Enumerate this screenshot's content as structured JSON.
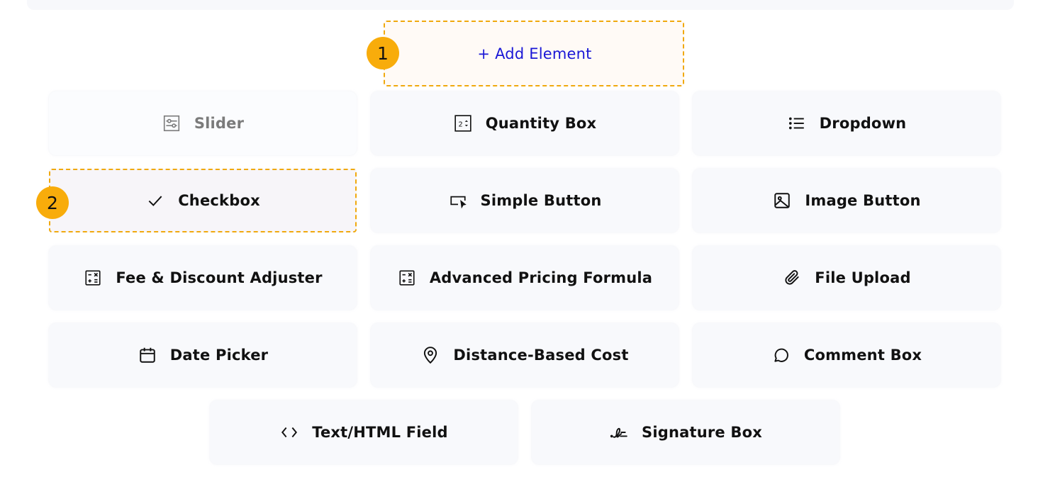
{
  "add_element": {
    "label": "+ Add Element"
  },
  "markers": [
    "1",
    "2"
  ],
  "colors": {
    "accent": "#f0a90e",
    "marker": "#f8ac0b",
    "link": "#1a17d6",
    "card_bg": "#f8f9fc",
    "disabled_text": "#7b7b7b"
  },
  "elements": [
    {
      "label": "Slider",
      "icon": "slider-icon",
      "state": "disabled"
    },
    {
      "label": "Quantity Box",
      "icon": "quantity-box-icon",
      "state": "normal"
    },
    {
      "label": "Dropdown",
      "icon": "list-icon",
      "state": "normal"
    },
    {
      "label": "Checkbox",
      "icon": "checkmark-icon",
      "state": "selected"
    },
    {
      "label": "Simple Button",
      "icon": "button-cursor-icon",
      "state": "normal"
    },
    {
      "label": "Image Button",
      "icon": "image-icon",
      "state": "normal"
    },
    {
      "label": "Fee & Discount Adjuster",
      "icon": "calculator-icon",
      "state": "normal"
    },
    {
      "label": "Advanced Pricing Formula",
      "icon": "calculator-icon",
      "state": "normal"
    },
    {
      "label": "File Upload",
      "icon": "paperclip-icon",
      "state": "normal"
    },
    {
      "label": "Date Picker",
      "icon": "calendar-icon",
      "state": "normal"
    },
    {
      "label": "Distance-Based Cost",
      "icon": "map-pin-icon",
      "state": "normal"
    },
    {
      "label": "Comment Box",
      "icon": "comment-icon",
      "state": "normal"
    },
    {
      "label": "Text/HTML Field",
      "icon": "code-icon",
      "state": "normal"
    },
    {
      "label": "Signature Box",
      "icon": "signature-icon",
      "state": "normal"
    }
  ]
}
